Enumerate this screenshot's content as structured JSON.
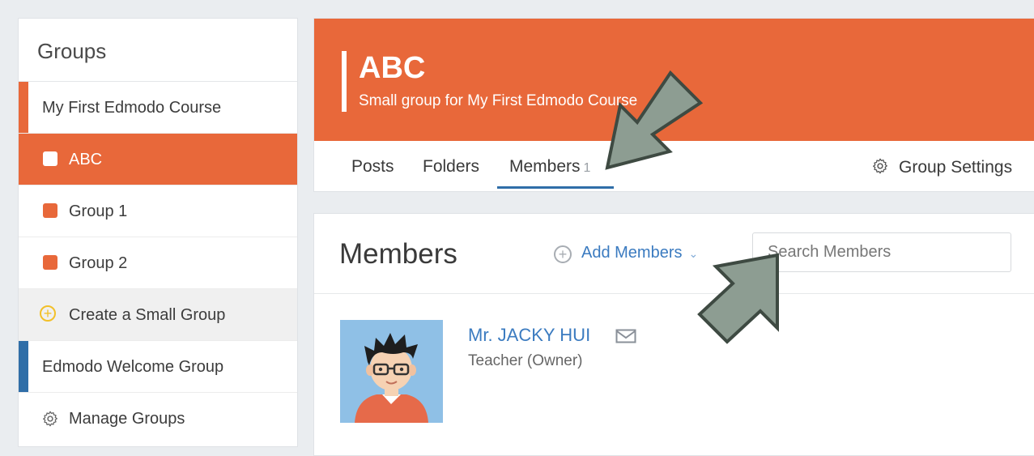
{
  "sidebar": {
    "title": "Groups",
    "course": "My First Edmodo Course",
    "small_groups": [
      {
        "label": "ABC",
        "active": true
      },
      {
        "label": "Group 1",
        "active": false
      },
      {
        "label": "Group 2",
        "active": false
      }
    ],
    "create_label": "Create a Small Group",
    "welcome_group": "Edmodo Welcome Group",
    "manage_label": "Manage Groups"
  },
  "header": {
    "group_name": "ABC",
    "group_desc": "Small group for My First Edmodo Course",
    "tabs": [
      {
        "label": "Posts"
      },
      {
        "label": "Folders"
      },
      {
        "label": "Members",
        "count": "1"
      }
    ],
    "settings_label": "Group Settings"
  },
  "members": {
    "title": "Members",
    "add_label": "Add Members",
    "search_placeholder": "Search Members",
    "list": [
      {
        "name": "Mr. JACKY HUI",
        "role": "Teacher (Owner)"
      }
    ]
  },
  "colors": {
    "accent": "#e8683a",
    "link": "#3b7bc0",
    "tab_underline": "#2f6ea8",
    "arrow": "#8d9d92"
  }
}
